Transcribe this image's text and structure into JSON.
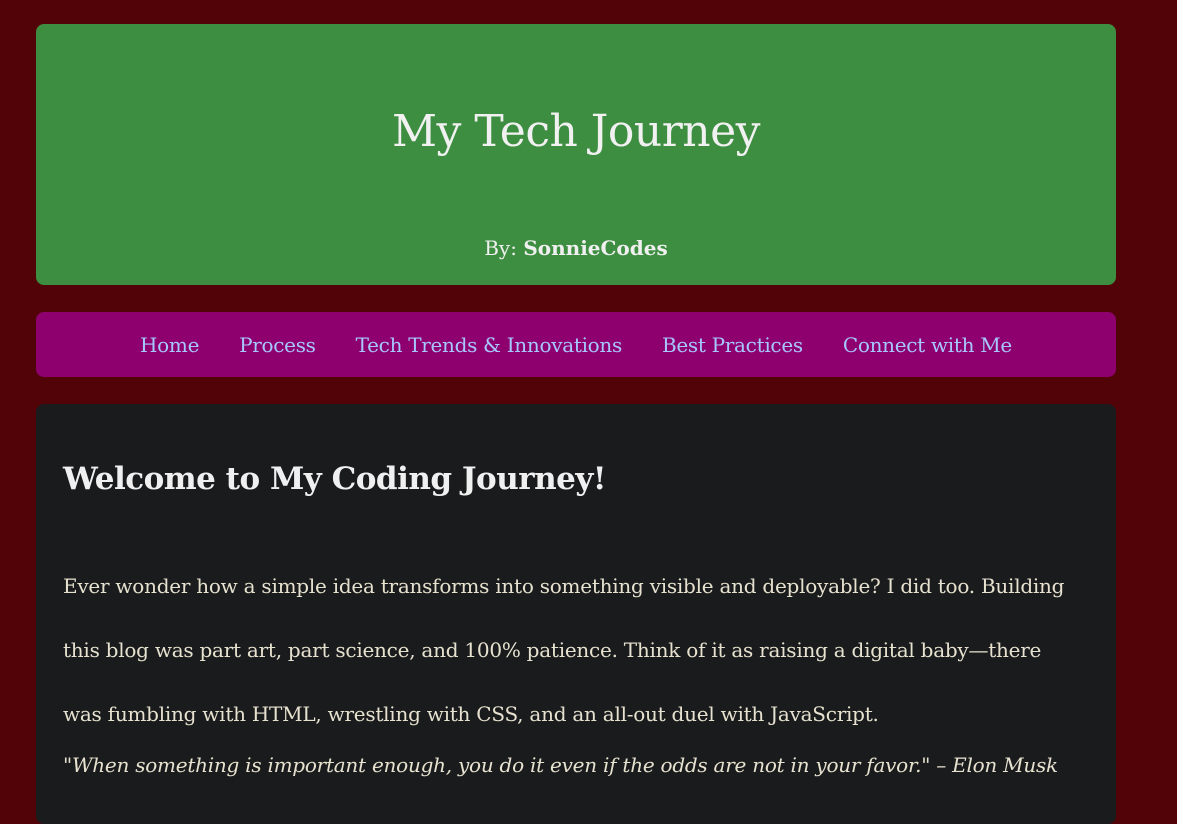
{
  "header": {
    "title": "My Tech Journey",
    "byline_prefix": "By: ",
    "author": "SonnieCodes"
  },
  "nav": {
    "items": [
      {
        "label": "Home"
      },
      {
        "label": "Process"
      },
      {
        "label": "Tech Trends & Innovations"
      },
      {
        "label": "Best Practices"
      },
      {
        "label": "Connect with Me"
      }
    ]
  },
  "main": {
    "heading": "Welcome to My Coding Journey!",
    "paragraph": "Ever wonder how a simple idea transforms into something visible and deployable? I did too. Building this blog was part art, part science, and 100% patience. Think of it as raising a digital baby—there was fumbling with HTML, wrestling with CSS, and an all-out duel with JavaScript.",
    "quote": "\"When something is important enough, you do it even if the odds are not in your favor.\" – Elon Musk"
  },
  "colors": {
    "page_background": "#520307",
    "header_background": "#3e8e41",
    "nav_background": "#8f006f",
    "nav_link": "#a7c7ff",
    "content_background": "#1a1b1d",
    "text": "#e7e2cf"
  }
}
